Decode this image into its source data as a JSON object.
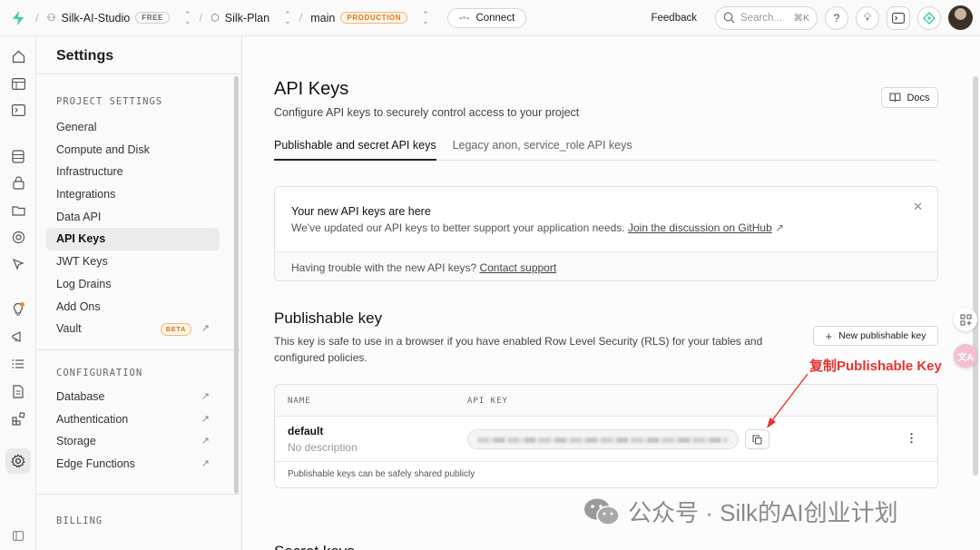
{
  "topbar": {
    "org_name": "Silk-AI-Studio",
    "org_badge": "FREE",
    "project_name": "Silk-Plan",
    "branch": "main",
    "branch_badge": "PRODUCTION",
    "connect_label": "Connect",
    "feedback_label": "Feedback",
    "search_placeholder": "Search...",
    "search_shortcut": "⌘K"
  },
  "settings": {
    "title": "Settings",
    "project_section": "PROJECT SETTINGS",
    "project_items": [
      "General",
      "Compute and Disk",
      "Infrastructure",
      "Integrations",
      "Data API",
      "API Keys",
      "JWT Keys",
      "Log Drains",
      "Add Ons",
      "Vault"
    ],
    "vault_badge": "BETA",
    "config_section": "CONFIGURATION",
    "config_items": [
      "Database",
      "Authentication",
      "Storage",
      "Edge Functions"
    ],
    "billing_section": "BILLING"
  },
  "main": {
    "title": "API Keys",
    "subtitle": "Configure API keys to securely control access to your project",
    "docs_label": "Docs",
    "tabs": [
      "Publishable and secret API keys",
      "Legacy anon, service_role API keys"
    ],
    "notice": {
      "heading": "Your new API keys are here",
      "body": "We've updated our API keys to better support your application needs.",
      "link": "Join the discussion on GitHub",
      "footer_text": "Having trouble with the new API keys?",
      "footer_link": "Contact support"
    },
    "publishable": {
      "title": "Publishable key",
      "description": "This key is safe to use in a browser if you have enabled Row Level Security (RLS) for your tables and configured policies.",
      "new_button": "New publishable key",
      "col_name": "NAME",
      "col_key": "API KEY",
      "row_name": "default",
      "row_desc": "No description",
      "footer_note": "Publishable keys can be safely shared publicly"
    },
    "secret_title": "Secret keys"
  },
  "annotation": "复制Publishable Key",
  "watermark": "公众号 · Silk的AI创业计划",
  "colors": {
    "brand_green": "#3ecf8e",
    "annotation_red": "#e8332f",
    "badge_orange": "#d3781a"
  }
}
